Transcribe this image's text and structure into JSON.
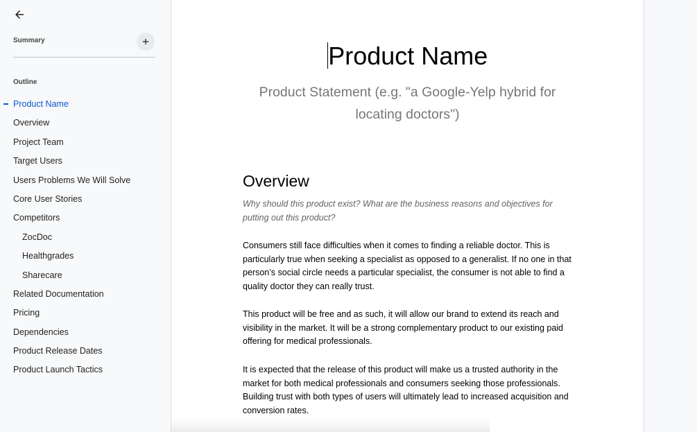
{
  "sidebar": {
    "summary_label": "Summary",
    "outline_label": "Outline",
    "items": [
      {
        "label": "Product Name",
        "active": true,
        "sub": false
      },
      {
        "label": "Overview",
        "active": false,
        "sub": false
      },
      {
        "label": "Project Team",
        "active": false,
        "sub": false
      },
      {
        "label": "Target Users",
        "active": false,
        "sub": false
      },
      {
        "label": "Users Problems We Will Solve",
        "active": false,
        "sub": false
      },
      {
        "label": "Core User Stories",
        "active": false,
        "sub": false
      },
      {
        "label": "Competitors",
        "active": false,
        "sub": false
      },
      {
        "label": "ZocDoc",
        "active": false,
        "sub": true
      },
      {
        "label": "Healthgrades",
        "active": false,
        "sub": true
      },
      {
        "label": "Sharecare",
        "active": false,
        "sub": true
      },
      {
        "label": "Related Documentation",
        "active": false,
        "sub": false
      },
      {
        "label": "Pricing",
        "active": false,
        "sub": false
      },
      {
        "label": "Dependencies",
        "active": false,
        "sub": false
      },
      {
        "label": "Product Release Dates",
        "active": false,
        "sub": false
      },
      {
        "label": "Product Launch Tactics",
        "active": false,
        "sub": false
      }
    ],
    "accent_color": "#0b57d0"
  },
  "document": {
    "title": "Product Name",
    "subtitle": "Product Statement (e.g. \"a Google-Yelp hybrid for locating doctors\")",
    "overview_heading": "Overview",
    "overview_prompt": "Why should this product exist? What are the business reasons and objectives for putting out this product?",
    "paragraphs": [
      "Consumers still face difficulties when it comes to finding a reliable doctor. This is particularly true when seeking a specialist as opposed to a generalist. If no one in that person’s social circle needs a particular specialist, the consumer is not able to find a quality doctor they can really trust.",
      "This product will be free and as such, it will allow our brand to extend its reach and visibility in the market. It will be a strong complementary product to our existing paid offering for medical professionals.",
      "It is expected that the release of this product will make us a trusted authority in the market for both medical professionals and consumers seeking those professionals. Building trust with both types of users will ultimately lead to increased acquisition and conversion rates."
    ]
  },
  "icons": {
    "back": "arrow-left-icon",
    "add": "plus-icon"
  }
}
